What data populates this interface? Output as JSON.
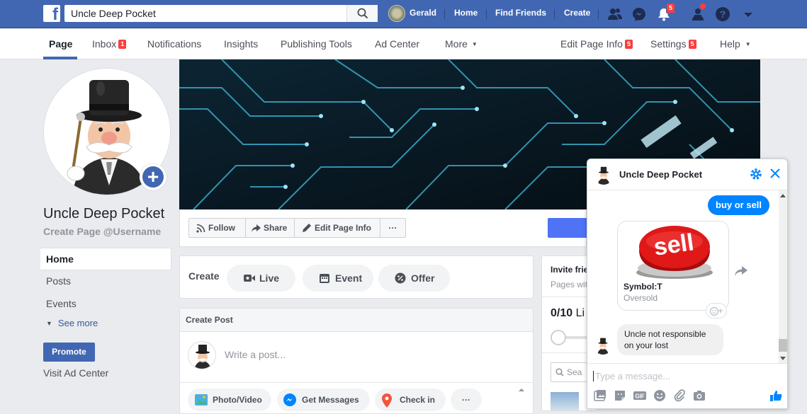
{
  "topbar": {
    "search_value": "Uncle Deep Pocket",
    "user_name": "Gerald",
    "home": "Home",
    "find_friends": "Find Friends",
    "create": "Create",
    "notif_badge": "5",
    "accent": "#4267b2"
  },
  "subnav": {
    "page": "Page",
    "inbox": "Inbox",
    "inbox_badge": "1",
    "notifications": "Notifications",
    "insights": "Insights",
    "publishing_tools": "Publishing Tools",
    "ad_center": "Ad Center",
    "more": "More",
    "edit_page_info": "Edit Page Info",
    "edit_badge": "5",
    "settings": "Settings",
    "settings_badge": "5",
    "help": "Help"
  },
  "profile": {
    "name": "Uncle Deep Pocket",
    "username": "Create Page @Username",
    "menu": [
      {
        "label": "Home"
      },
      {
        "label": "Posts"
      },
      {
        "label": "Events"
      }
    ],
    "see_more": "See more",
    "promote": "Promote",
    "visit_ad_center": "Visit Ad Center"
  },
  "actions": {
    "follow": "Follow",
    "share": "Share",
    "edit_page_info": "Edit Page Info",
    "more": "···"
  },
  "create": {
    "label": "Create",
    "live": "Live",
    "event": "Event",
    "offer": "Offer"
  },
  "post": {
    "header": "Create Post",
    "placeholder": "Write a post...",
    "photo_video": "Photo/Video",
    "get_messages": "Get Messages",
    "check_in": "Check in",
    "more": "···"
  },
  "invite": {
    "title": "Invite frie",
    "subtitle": "Pages wit",
    "count": "0/10",
    "count_suffix": " Li",
    "search_placeholder": "Sea"
  },
  "chat": {
    "name": "Uncle Deep Pocket",
    "msg_me": "buy or sell",
    "card_image_text": "sell",
    "card_title": "Symbol:T",
    "card_subtitle": "Oversold",
    "msg_them": "Uncle not responsible on your lost",
    "input_placeholder": "Type a message...",
    "bubble_color": "#0084ff"
  }
}
